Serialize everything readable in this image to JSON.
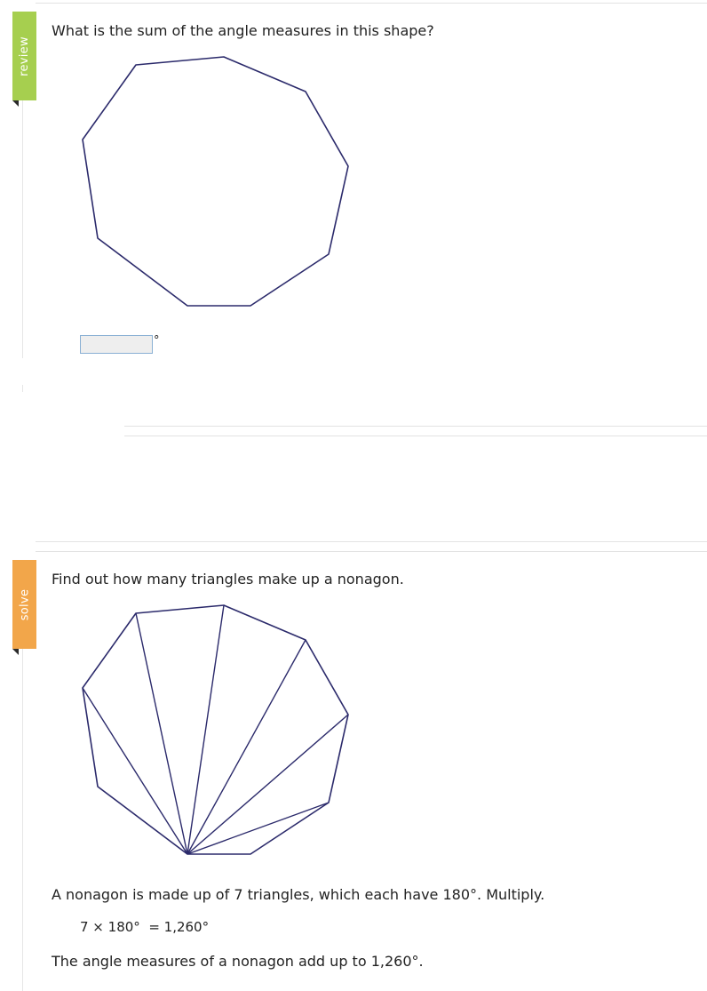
{
  "review": {
    "tab_label": "review",
    "question": "What is the sum of the angle measures in this shape?",
    "answer_value": "",
    "unit": "°"
  },
  "solve": {
    "tab_label": "solve",
    "prompt": "Find out how many triangles make up a nonagon.",
    "explanation": "A nonagon is made up of 7 triangles, which each have 180°. Multiply.",
    "equation": "7 × 180°  = 1,260°",
    "conclusion": "The angle measures of a nonagon add up to 1,260°."
  },
  "colors": {
    "review_tab": "#a6cf4f",
    "solve_tab": "#f2a64a",
    "shape_stroke": "#2b2a6b",
    "input_border": "#8ab0d4",
    "input_bg": "#eeeeee"
  }
}
